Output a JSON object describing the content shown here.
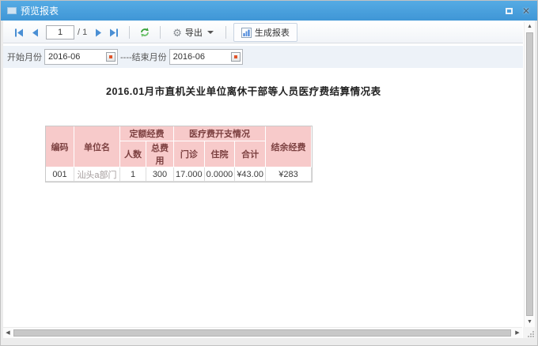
{
  "window": {
    "title": "预览报表"
  },
  "colors": {
    "titlebar_blue": "#47a0df",
    "table_header_bg": "#f7caca",
    "table_header_text": "#7c4040",
    "nav_icon_blue": "#4a8fd4",
    "refresh_green": "#3aa33a"
  },
  "toolbar": {
    "page_input_value": "1",
    "page_total": "/ 1",
    "export_label": "导出",
    "generate_label": "生成报表"
  },
  "filters": {
    "start_label": "开始月份",
    "start_value": "2016-06",
    "end_label": "----结束月份",
    "end_value": "2016-06"
  },
  "report": {
    "title": "2016.01月市直机关业单位离休干部等人员医疗费结算情况表",
    "table": {
      "headers": {
        "code": "编码",
        "unit": "单位名",
        "quota_group": "定额经费",
        "medical_group": "医疗费开支情况",
        "balance": "结余经费"
      },
      "sub_headers": {
        "people": "人数",
        "total_fee": "总费用",
        "outpatient": "门诊",
        "inpatient": "住院",
        "sum": "合计"
      },
      "rows": [
        {
          "code": "001",
          "unit": "汕头a部门",
          "people": "1",
          "total_fee": "300",
          "outpatient": "17.000",
          "inpatient": "0.0000",
          "sum": "¥43.00",
          "balance": "¥283"
        }
      ]
    }
  },
  "icons": {
    "gear": "⚙",
    "close": "✕",
    "scroll_up": "▲",
    "scroll_down": "▼",
    "scroll_left": "◀",
    "scroll_right": "▶"
  }
}
